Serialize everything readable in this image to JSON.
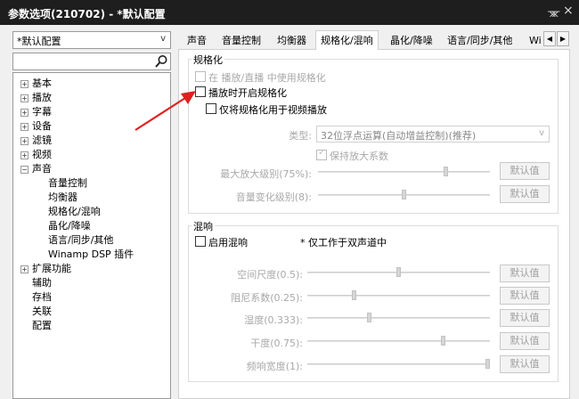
{
  "window": {
    "title": "参数选项(210702) - *默认配置",
    "pin_glyph": "ᚘ",
    "close_glyph": "×"
  },
  "preset": {
    "value": "*默认配置",
    "arrow": "v"
  },
  "search": {
    "value": ""
  },
  "tree": {
    "items": [
      {
        "label": "基本",
        "toggle": "+"
      },
      {
        "label": "播放",
        "toggle": "+"
      },
      {
        "label": "字幕",
        "toggle": "+"
      },
      {
        "label": "设备",
        "toggle": "+"
      },
      {
        "label": "滤镜",
        "toggle": "+"
      },
      {
        "label": "视频",
        "toggle": "+"
      },
      {
        "label": "声音",
        "toggle": "−"
      },
      {
        "label": "音量控制"
      },
      {
        "label": "均衡器"
      },
      {
        "label": "规格化/混响"
      },
      {
        "label": "晶化/降噪"
      },
      {
        "label": "语言/同步/其他"
      },
      {
        "label": "Winamp DSP 插件"
      },
      {
        "label": "扩展功能",
        "toggle": "+"
      },
      {
        "label": "辅助"
      },
      {
        "label": "存档"
      },
      {
        "label": "关联"
      },
      {
        "label": "配置"
      }
    ]
  },
  "tabs": [
    {
      "label": "声音"
    },
    {
      "label": "音量控制"
    },
    {
      "label": "均衡器"
    },
    {
      "label": "规格化/混响",
      "active": true
    },
    {
      "label": "晶化/降噪"
    },
    {
      "label": "语言/同步/其他"
    },
    {
      "label": "Wi"
    }
  ],
  "tab_scroll": {
    "left": "◀",
    "right": "▶"
  },
  "normalize": {
    "title": "规格化",
    "opt_live": "在 播放/直播 中使用规格化",
    "opt_enable": "播放时开启规格化",
    "opt_video_only": "仅将规格化用于视频播放",
    "type_label": "类型:",
    "type_value": "32位浮点运算(自动增益控制)(推荐)",
    "type_arrow": "v",
    "keep_gain": "保持放大系数",
    "max_gain_label": "最大放大级别(75%):",
    "max_gain_level": 0.75,
    "volume_change_label": "音量变化级别(8):",
    "volume_change_level": 0.5,
    "default_btn": "默认值"
  },
  "reverb": {
    "title": "混响",
    "opt_enable": "启用混响",
    "stereo_note": "* 仅工作于双声道中",
    "params": [
      {
        "label": "空间尺度(0.5):",
        "level": 0.5
      },
      {
        "label": "阻尼系数(0.25):",
        "level": 0.25
      },
      {
        "label": "湿度(0.333):",
        "level": 0.333
      },
      {
        "label": "干度(0.75):",
        "level": 0.75
      },
      {
        "label": "频响宽度(1):",
        "level": 1.0
      }
    ],
    "default_btn": "默认值"
  }
}
